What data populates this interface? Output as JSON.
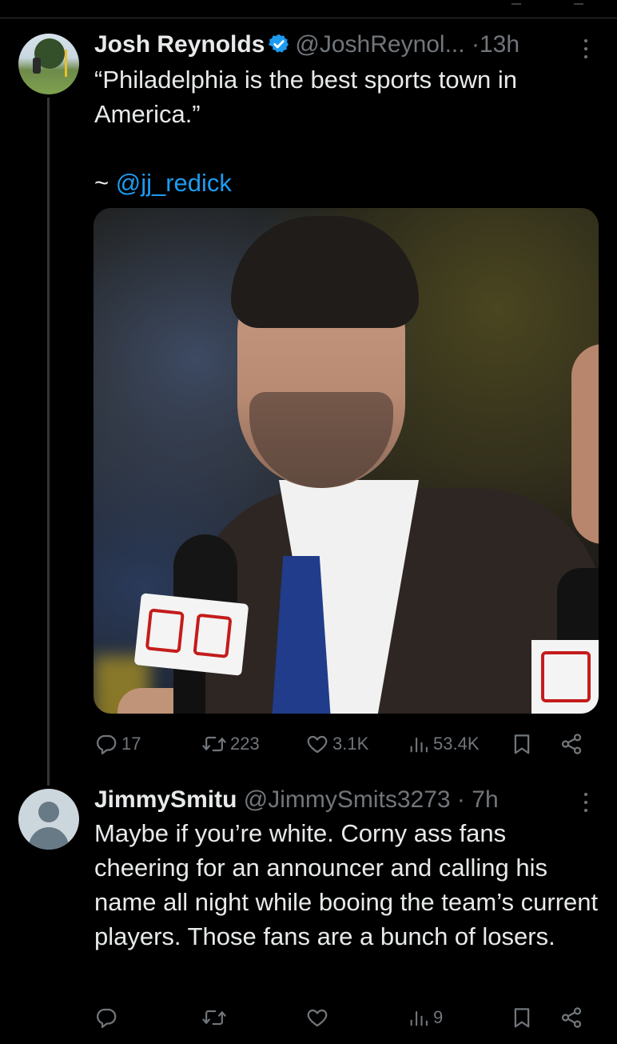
{
  "tweet": {
    "author_name": "Josh Reynolds",
    "author_handle": "@JoshReynol...",
    "separator": "·",
    "time": "13h",
    "text": "“Philadelphia is the best sports town in America.”",
    "attribution_prefix": "~",
    "mention": "@jj_redick",
    "image_icon": "photo",
    "stats": {
      "replies": "17",
      "retweets": "223",
      "likes": "3.1K",
      "views": "53.4K"
    }
  },
  "reply": {
    "author_name": "JimmySmitu",
    "author_handle": "@JimmySmits3273",
    "separator": "·",
    "time": "7h",
    "text": "Maybe if you’re white. Corny ass fans cheering for an announcer and calling his name all night while booing the team’s current players. Those fans are a bunch of losers.",
    "stats": {
      "views": "9"
    }
  },
  "colors": {
    "background": "#000000",
    "text": "#e7e9ea",
    "muted": "#71767b",
    "accent": "#1d9bf0"
  },
  "icons": [
    "reply-icon",
    "retweet-icon",
    "like-icon",
    "views-icon",
    "bookmark-icon",
    "share-icon",
    "more-icon",
    "verified-icon"
  ]
}
